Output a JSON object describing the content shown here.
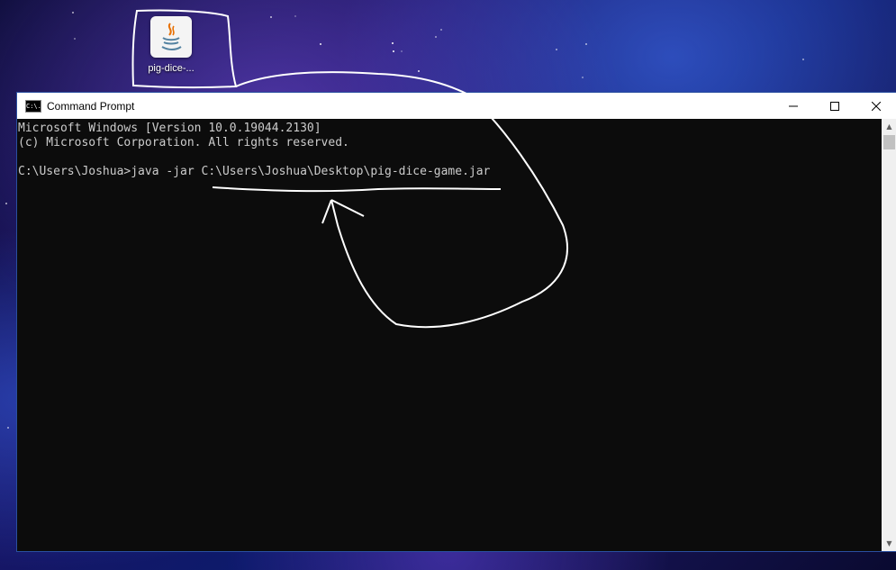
{
  "desktop": {
    "icon_label": "pig-dice-...",
    "icon_name": "java-jar-icon"
  },
  "window": {
    "title": "Command Prompt",
    "app_icon_text": "C:\\.",
    "minimize_label": "—",
    "maximize_label": "☐",
    "close_label": "✕"
  },
  "console": {
    "lines": [
      "Microsoft Windows [Version 10.0.19044.2130]",
      "(c) Microsoft Corporation. All rights reserved.",
      "",
      "C:\\Users\\Joshua>java -jar C:\\Users\\Joshua\\Desktop\\pig-dice-game.jar"
    ]
  },
  "colors": {
    "console_bg": "#0c0c0c",
    "console_text": "#cccccc",
    "annotation": "#ffffff"
  }
}
